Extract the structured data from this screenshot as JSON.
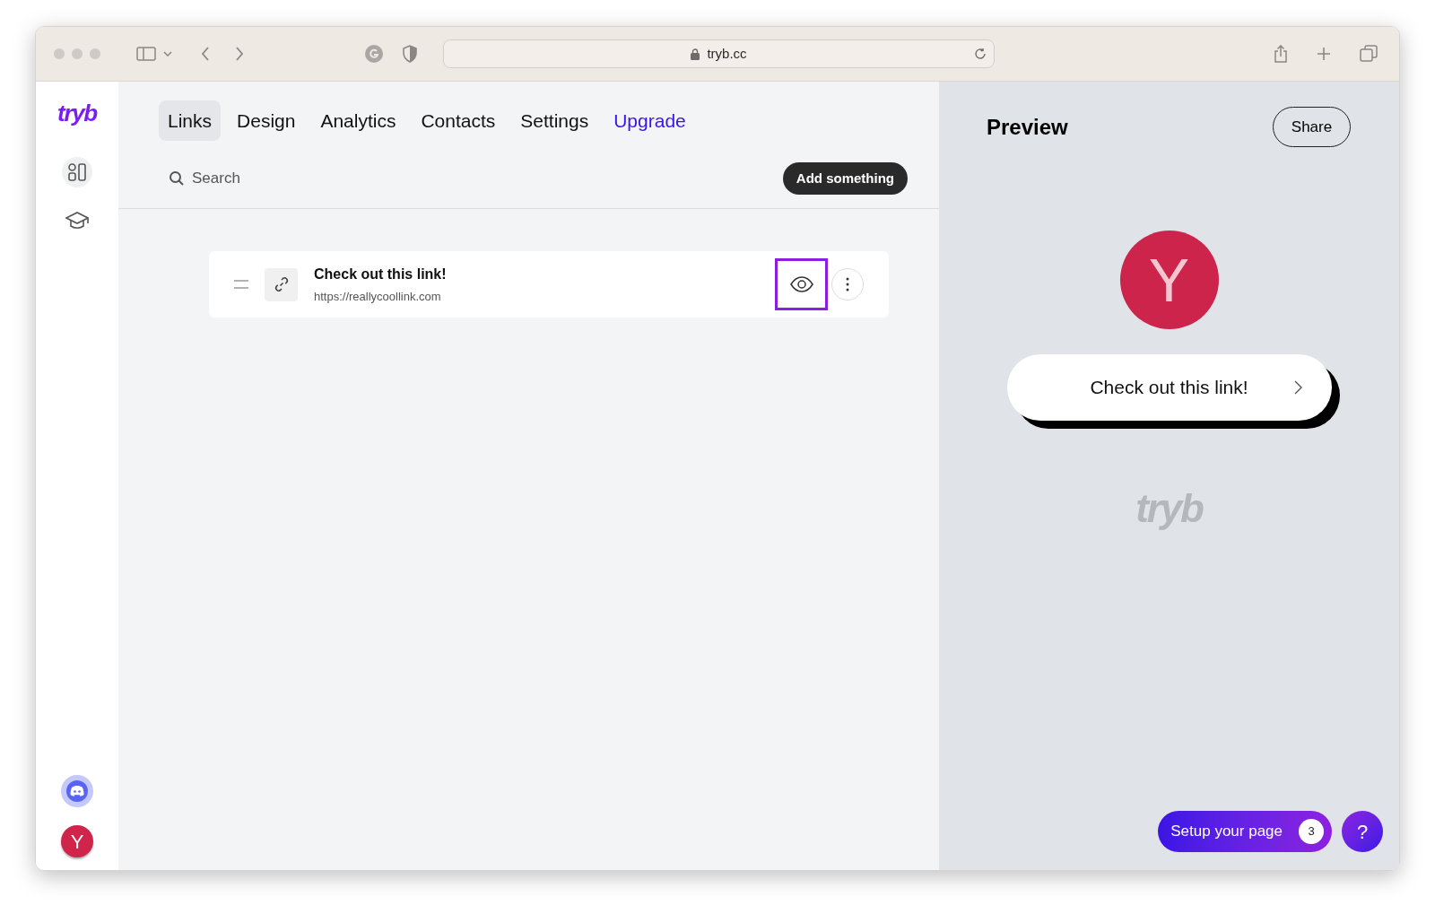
{
  "browser": {
    "address": "tryb.cc"
  },
  "sidebar": {
    "logo": "tryb",
    "avatar_letter": "Y"
  },
  "tabs": [
    {
      "label": "Links",
      "selected": true,
      "kind": "normal"
    },
    {
      "label": "Design",
      "selected": false,
      "kind": "normal"
    },
    {
      "label": "Analytics",
      "selected": false,
      "kind": "normal"
    },
    {
      "label": "Contacts",
      "selected": false,
      "kind": "normal"
    },
    {
      "label": "Settings",
      "selected": false,
      "kind": "normal"
    },
    {
      "label": "Upgrade",
      "selected": false,
      "kind": "upgrade"
    }
  ],
  "search": {
    "placeholder": "Search"
  },
  "add_button": "Add something",
  "links": [
    {
      "title": "Check out this link!",
      "url": "https://reallycoollink.com",
      "visible_highlighted": true
    }
  ],
  "preview": {
    "title": "Preview",
    "share": "Share",
    "avatar_letter": "Y",
    "links": [
      "Check out this link!"
    ],
    "footer_logo": "tryb"
  },
  "setup": {
    "label": "Setup your page",
    "count": "3"
  },
  "help": "?"
}
